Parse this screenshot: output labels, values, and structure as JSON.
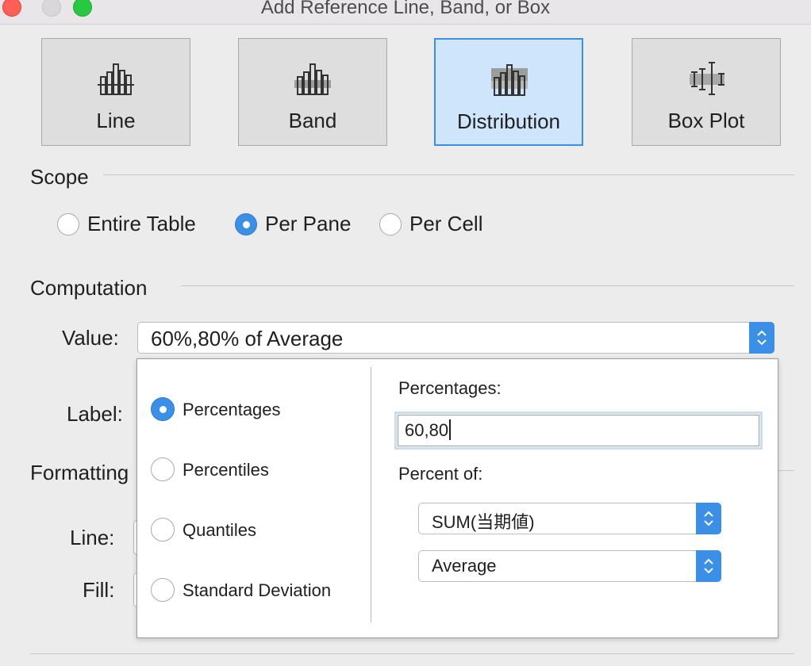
{
  "window": {
    "title": "Add Reference Line, Band, or Box"
  },
  "types": [
    {
      "label": "Line",
      "icon": "reference-line-icon",
      "selected": false
    },
    {
      "label": "Band",
      "icon": "reference-band-icon",
      "selected": false
    },
    {
      "label": "Distribution",
      "icon": "distribution-icon",
      "selected": true
    },
    {
      "label": "Box Plot",
      "icon": "box-plot-icon",
      "selected": false
    }
  ],
  "scope": {
    "header": "Scope",
    "options": [
      "Entire Table",
      "Per Pane",
      "Per Cell"
    ],
    "selected": "Per Pane"
  },
  "computation": {
    "header": "Computation",
    "value_label": "Value:",
    "value": "60%,80% of Average",
    "label_label": "Label:"
  },
  "formatting": {
    "header": "Formatting",
    "line_label": "Line:",
    "fill_label": "Fill:"
  },
  "popover": {
    "options": [
      "Percentages",
      "Percentiles",
      "Quantiles",
      "Standard Deviation"
    ],
    "selected": "Percentages",
    "percentages_label": "Percentages:",
    "percentages_value": "60,80",
    "percent_of_label": "Percent of:",
    "measure": "SUM(当期値)",
    "aggregation": "Average"
  },
  "colors": {
    "accent": "#3b8fe6",
    "selected_bg": "#cfe5fb"
  }
}
